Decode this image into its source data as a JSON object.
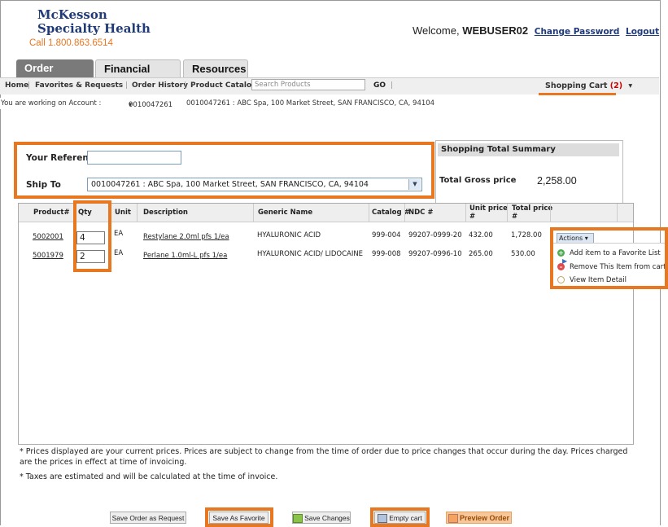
{
  "brand": {
    "line1": "McKesson",
    "line2": "Specialty Health",
    "phone": "Call  1.800.863.6514"
  },
  "header": {
    "welcome": "Welcome,",
    "user": "WEBUSER02",
    "change_password": "Change Password",
    "logout": "Logout"
  },
  "tabs": [
    {
      "label": "Order Center",
      "active": true
    },
    {
      "label": "Financial Tools",
      "active": false
    },
    {
      "label": "Resources",
      "active": false
    }
  ],
  "nav": {
    "home": "Home",
    "favorites": "Favorites & Requests",
    "history": "Order History",
    "catalog": "Product Catalog",
    "search_placeholder": "Search Products",
    "go": "GO",
    "cart_label": "Shopping Cart",
    "cart_count": "(2)",
    "cart_arrow": "▾"
  },
  "account": {
    "label": "You are working on Account :",
    "number": "0010047261",
    "arrow": "▾",
    "detail": "0010047261 : ABC Spa, 100 Market Street, SAN FRANCISCO, CA, 94104"
  },
  "form": {
    "reference_label": "Your Reference",
    "reference_value": "",
    "ship_to_label": "Ship To",
    "ship_to_value": "0010047261 : ABC Spa, 100 Market Street, SAN FRANCISCO, CA, 94104"
  },
  "summary": {
    "title": "Shopping Total Summary",
    "gross_label": "Total Gross price",
    "gross_value": "2,258.00"
  },
  "table": {
    "headers": [
      "Product#",
      "Qty",
      "Unit",
      "Description",
      "Generic Name",
      "Catalog #",
      "NDC #",
      "Unit price",
      "#",
      "Total price",
      "#"
    ],
    "rows": [
      {
        "product": "5002001",
        "qty": "4",
        "unit": "EA",
        "description": "Restylane 2.0ml pfs 1/ea",
        "generic": "HYALURONIC ACID",
        "catalog": "999-004",
        "ndc": "99207-0999-20",
        "unit_price": "432.00",
        "total": "1,728.00"
      },
      {
        "product": "5001979",
        "qty": "2",
        "unit": "EA",
        "description": "Perlane 1.0ml-L pfs 1/ea",
        "generic": "HYALURONIC ACID/ LIDOCAINE",
        "catalog": "999-008",
        "ndc": "99207-0996-10",
        "unit_price": "265.00",
        "total": "530.00"
      }
    ]
  },
  "actions": {
    "button": "Actions ▾",
    "items": [
      "Add item to a Favorite List",
      "Remove This Item from cart",
      "View Item Detail"
    ]
  },
  "notes": {
    "prices": "* Prices displayed are your current prices.  Prices are subject to change from the time of order due to price changes that occur during the day. Prices charged are the prices in effect at time of invoicing.",
    "taxes": "* Taxes are estimated and will be calculated at the time of invoice."
  },
  "buttons": {
    "save_request": "Save Order as Request",
    "save_favorite": "Save As Favorite",
    "save_changes": "Save Changes",
    "empty_cart": "Empty cart",
    "preview": "Preview Order"
  },
  "colors": {
    "accent": "#e87722",
    "brand": "#1f3a76"
  }
}
